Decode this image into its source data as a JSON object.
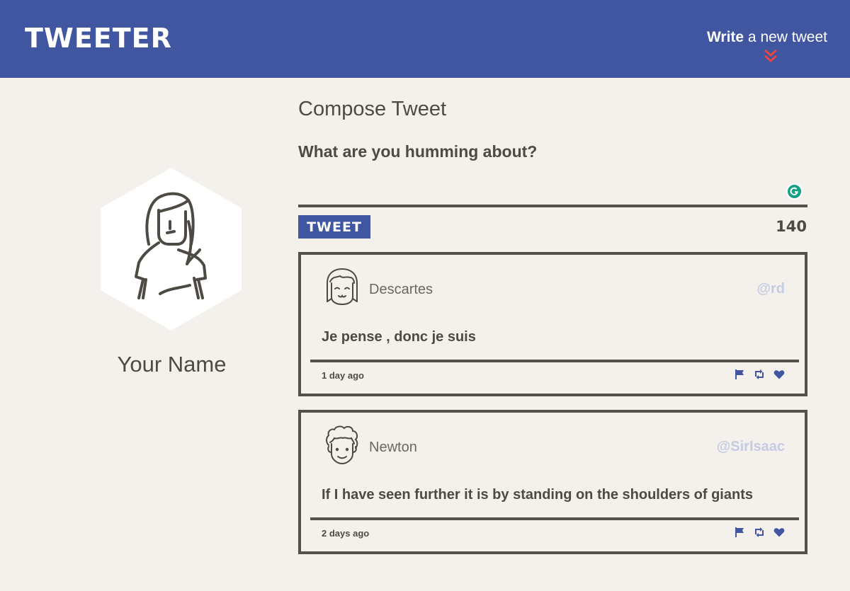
{
  "nav": {
    "logo": "TWEETER",
    "write_bold": "Write",
    "write_rest": " a new tweet"
  },
  "profile": {
    "name": "Your Name"
  },
  "compose": {
    "title": "Compose Tweet",
    "prompt": "What are you humming about?",
    "button": "TWEET",
    "counter": "140"
  },
  "tweets": [
    {
      "name": "Descartes",
      "handle": "@rd",
      "text": "Je pense , donc je suis",
      "time": "1 day ago"
    },
    {
      "name": "Newton",
      "handle": "@SirIsaac",
      "text": "If I have seen further it is by standing on the shoulders of giants",
      "time": "2 days ago"
    }
  ],
  "colors": {
    "nav": "#4056a1",
    "background": "#f4f1ec",
    "text": "#4d4a44",
    "handle": "#c4cbe3",
    "chevron": "#e84545"
  },
  "icons": [
    "chevron-double-down-icon",
    "grammarly-icon",
    "flag-icon",
    "retweet-icon",
    "heart-icon"
  ]
}
